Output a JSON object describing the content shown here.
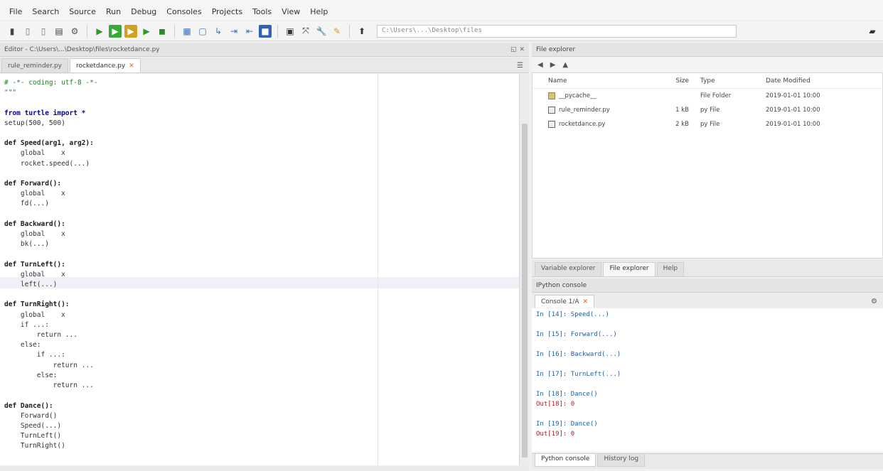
{
  "menubar": {
    "items": [
      "File",
      "Search",
      "Source",
      "Run",
      "Debug",
      "Consoles",
      "Projects",
      "Tools",
      "View",
      "Help"
    ]
  },
  "toolbar": {
    "path": "C:\\Users\\...\\Desktop\\files"
  },
  "editor": {
    "pane_title": "Editor - C:\\Users\\...\\Desktop\\files\\rocketdance.py",
    "tabs": [
      {
        "label": "rule_reminder.py",
        "active": false
      },
      {
        "label": "rocketdance.py",
        "active": true
      }
    ],
    "code": [
      {
        "t": "# -*- coding: utf-8 -*-",
        "c": "cm"
      },
      {
        "t": "\"\"\"",
        "c": "cm"
      },
      {
        "t": "",
        "c": ""
      },
      {
        "t": "from turtle import *",
        "c": "kw"
      },
      {
        "t": "setup(500, 500)",
        "c": ""
      },
      {
        "t": "",
        "c": ""
      },
      {
        "t": "def Speed(arg1, arg2):",
        "c": "fn"
      },
      {
        "t": "    global    x",
        "c": ""
      },
      {
        "t": "    rocket.speed(...)",
        "c": ""
      },
      {
        "t": "",
        "c": ""
      },
      {
        "t": "def Forward():",
        "c": "fn"
      },
      {
        "t": "    global    x",
        "c": ""
      },
      {
        "t": "    fd(...)",
        "c": ""
      },
      {
        "t": "",
        "c": ""
      },
      {
        "t": "def Backward():",
        "c": "fn"
      },
      {
        "t": "    global    x",
        "c": ""
      },
      {
        "t": "    bk(...)",
        "c": ""
      },
      {
        "t": "",
        "c": ""
      },
      {
        "t": "def TurnLeft():",
        "c": "fn"
      },
      {
        "t": "    global    x",
        "c": ""
      },
      {
        "t": "    left(...)",
        "c": ""
      },
      {
        "t": "",
        "c": ""
      },
      {
        "t": "def TurnRight():",
        "c": "fn"
      },
      {
        "t": "    global    x",
        "c": ""
      },
      {
        "t": "    if ...:",
        "c": ""
      },
      {
        "t": "        return ...",
        "c": ""
      },
      {
        "t": "    else:",
        "c": ""
      },
      {
        "t": "        if ...:",
        "c": ""
      },
      {
        "t": "            return ...",
        "c": ""
      },
      {
        "t": "        else:",
        "c": ""
      },
      {
        "t": "            return ...",
        "c": ""
      },
      {
        "t": "",
        "c": ""
      },
      {
        "t": "def Dance():",
        "c": "fn"
      },
      {
        "t": "    Forward()",
        "c": ""
      },
      {
        "t": "    Speed(...)",
        "c": ""
      },
      {
        "t": "    TurnLeft()",
        "c": ""
      },
      {
        "t": "    TurnRight()",
        "c": ""
      }
    ]
  },
  "file_explorer": {
    "title": "File explorer",
    "columns": [
      "Name",
      "Size",
      "Type",
      "Date Modified"
    ],
    "rows": [
      {
        "name": "__pycache__",
        "size": "",
        "type": "File Folder",
        "date": "2019-01-01 10:00",
        "folder": true
      },
      {
        "name": "rule_reminder.py",
        "size": "1 kB",
        "type": "py File",
        "date": "2019-01-01 10:00",
        "folder": false
      },
      {
        "name": "rocketdance.py",
        "size": "2 kB",
        "type": "py File",
        "date": "2019-01-01 10:00",
        "folder": false
      }
    ],
    "tabs": [
      {
        "label": "Variable explorer",
        "active": false
      },
      {
        "label": "File explorer",
        "active": true
      },
      {
        "label": "Help",
        "active": false
      }
    ]
  },
  "console": {
    "title": "IPython console",
    "tab": "Console 1/A",
    "lines": [
      {
        "t": "In [14]: Speed(...)",
        "c": "in"
      },
      {
        "t": "",
        "c": "gap"
      },
      {
        "t": "In [15]: Forward(...)",
        "c": "in"
      },
      {
        "t": "",
        "c": "gap"
      },
      {
        "t": "In [16]: Backward(...)",
        "c": "in"
      },
      {
        "t": "",
        "c": "gap"
      },
      {
        "t": "In [17]: TurnLeft(...)",
        "c": "in"
      },
      {
        "t": "",
        "c": "gap"
      },
      {
        "t": "In [18]: Dance()",
        "c": "in"
      },
      {
        "t": "Out[18]: 0",
        "c": "out"
      },
      {
        "t": "",
        "c": "gap"
      },
      {
        "t": "In [19]: Dance()",
        "c": "in"
      },
      {
        "t": "Out[19]: 0",
        "c": "out"
      }
    ],
    "bottom_tabs": [
      {
        "label": "Python console",
        "active": true
      },
      {
        "label": "History log",
        "active": false
      }
    ]
  }
}
